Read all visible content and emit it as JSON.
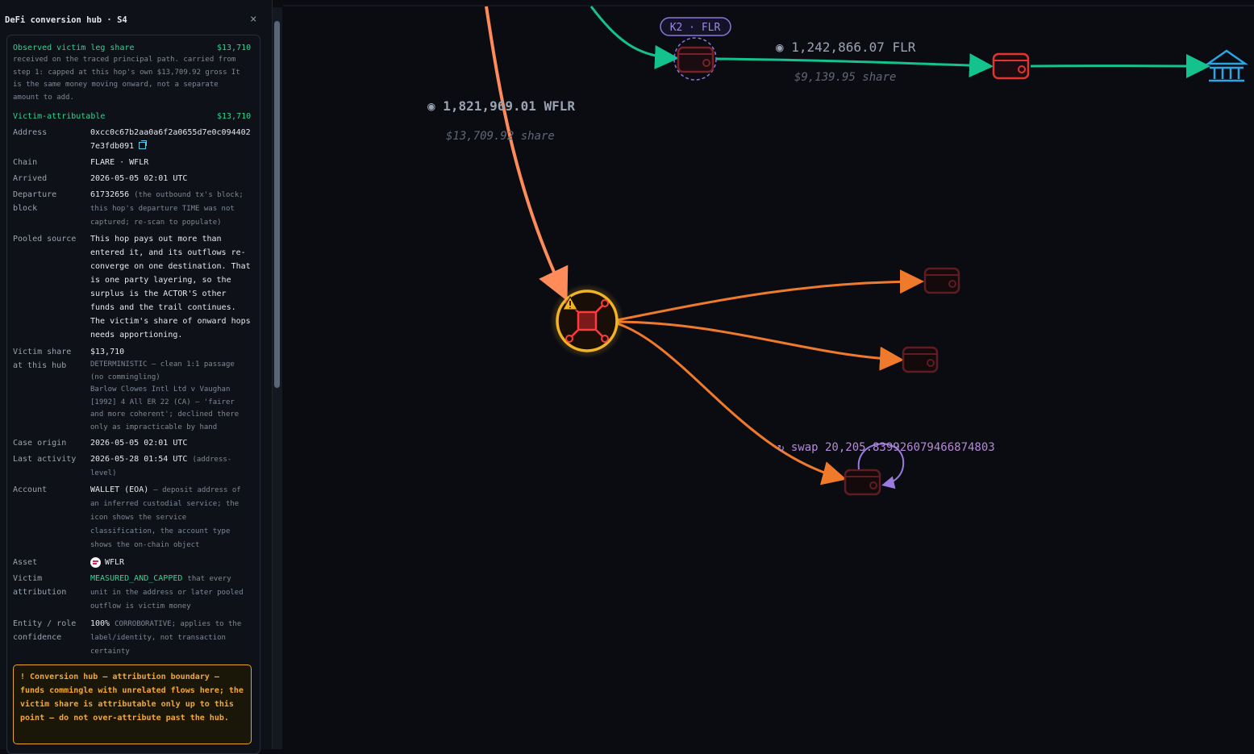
{
  "panel": {
    "title": "DeFi conversion hub · S4",
    "close_icon": "×",
    "observed": {
      "label": "Observed victim leg share",
      "value": "$13,710"
    },
    "observed_note": [
      "received on the traced principal path. carried from",
      "step 1: capped at this hop's own $13,709.92 gross It",
      "is the same money moving onward, not a separate",
      "amount to add."
    ],
    "victim_attr": {
      "label": "Victim-attributable",
      "value": "$13,710"
    },
    "address": {
      "label": "Address",
      "line1": "0xcc0c67b2aa0a6f2a0655d7e0c094402",
      "line2": "7e3fdb091"
    },
    "chain": {
      "label": "Chain",
      "value": "FLARE · WFLR"
    },
    "arrived": {
      "label": "Arrived",
      "value": "2026-05-05 02:01 UTC"
    },
    "departure": {
      "label1": "Departure",
      "label2": "block",
      "value": "61732656",
      "note1": "(the outbound tx's block;",
      "note2": "this hop's departure TIME was not",
      "note3": "captured; re-scan to populate)"
    },
    "pooled": {
      "label": "Pooled source",
      "lines": [
        "This hop pays out more than",
        "entered it, and its outflows re-",
        "converge on one destination. That",
        "is one party layering, so the",
        "surplus is the ACTOR'S other",
        "funds and the trail continues.",
        "The victim's share of onward hops",
        "needs apportioning."
      ]
    },
    "victim_share": {
      "label1": "Victim share",
      "label2": "at this hub",
      "value": "$13,710",
      "notes": [
        "DETERMINISTIC — clean 1:1 passage",
        "(no commingling)",
        "Barlow Clowes Intl Ltd v Vaughan",
        "[1992] 4 All ER 22 (CA) — 'fairer",
        "and more coherent'; declined there",
        "only as impracticable by hand"
      ]
    },
    "case_origin": {
      "label": "Case origin",
      "value": "2026-05-05 02:01 UTC"
    },
    "last_activity": {
      "label": "Last activity",
      "value": "2026-05-28 01:54 UTC",
      "note1": "(address-",
      "note2": "level)"
    },
    "account": {
      "label": "Account",
      "value": "WALLET (EOA)",
      "note1": "— deposit address of",
      "lines": [
        "an inferred custodial service; the",
        "icon shows the service",
        "classification, the account type",
        "shows the on-chain object"
      ]
    },
    "asset": {
      "label": "Asset",
      "value": "WFLR",
      "icon": "flare-token-icon"
    },
    "victim_attribution": {
      "label1": "Victim",
      "label2": "attribution",
      "value": "MEASURED_AND_CAPPED",
      "note1": "that every",
      "note2": "unit in the address or later pooled",
      "note3": "outflow is victim money"
    },
    "entity": {
      "label1": "Entity / role",
      "label2": "confidence",
      "value": "100%",
      "note1": "CORROBORATIVE; applies to the",
      "note2": "label/identity, not transaction",
      "note3": "certainty"
    },
    "warning": "! Conversion hub — attribution boundary — funds commingle with unrelated flows here; the victim share is attributable only up to this point — do not over-attribute past the hub."
  },
  "graph": {
    "k2_label": "K2 · FLR",
    "flr_amount": "◉ 1,242,866.07 FLR",
    "flr_share": "$9,139.95 share",
    "wflr_amount": "◉ 1,821,969.01 WFLR",
    "wflr_share": "$13,709.92 share",
    "swap_label": "↻ swap 20,205.839926079466874803"
  },
  "colors": {
    "green_edge": "#13c28c",
    "orange_edge": "#f07a2c",
    "salmon_edge": "#ff8a5a",
    "red_node": "#e3342f",
    "hub_glow": "#f3b423",
    "bank": "#2aa6e6",
    "purple": "#9b7be0"
  }
}
